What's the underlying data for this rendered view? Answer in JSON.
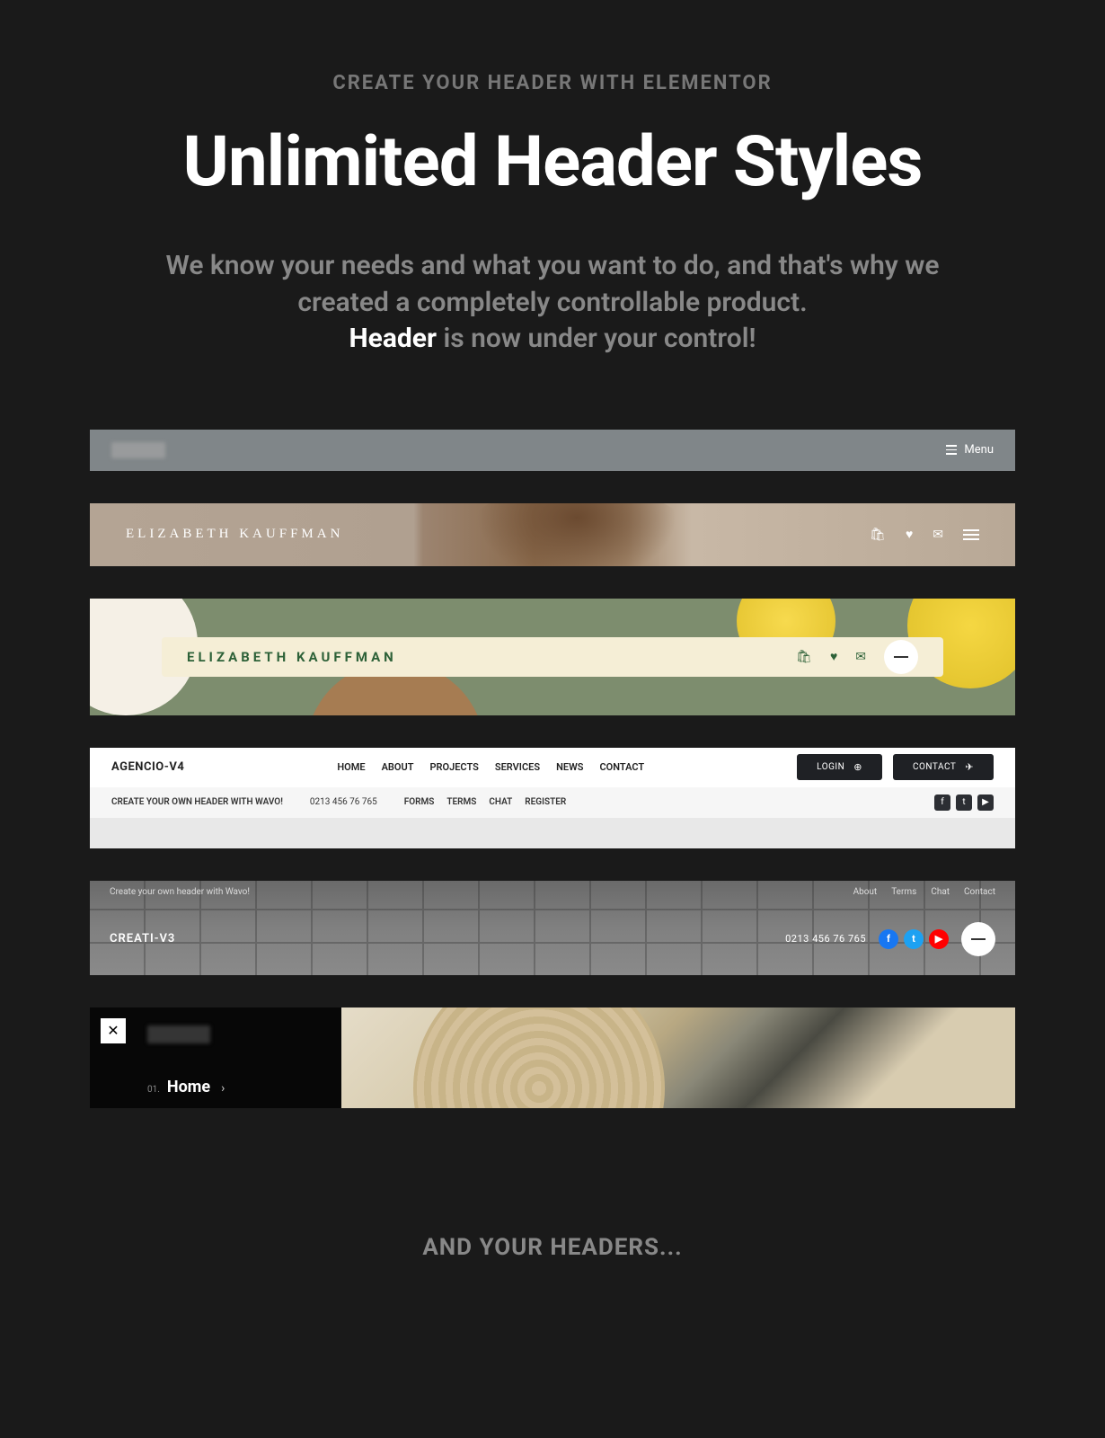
{
  "eyebrow": "CREATE YOUR HEADER WITH ELEMENTOR",
  "title": "Unlimited Header Styles",
  "desc_1": "We know your needs and what you want to do, and that's why we created a completely controllable product.",
  "desc_bold": "Header",
  "desc_2": " is now under your control!",
  "h1": {
    "menu": "Menu"
  },
  "h2": {
    "name": "ELIZABETH KAUFFMAN"
  },
  "h3": {
    "name": "ELIZABETH KAUFFMAN"
  },
  "h4": {
    "brand": "AGENCIO-V4",
    "nav": [
      "HOME",
      "ABOUT",
      "PROJECTS",
      "SERVICES",
      "NEWS",
      "CONTACT"
    ],
    "login": "LOGIN",
    "contact": "CONTACT",
    "sub_tag": "CREATE YOUR OWN HEADER WITH WAVO!",
    "sub_phone": "0213 456 76 765",
    "sub_links": [
      "FORMS",
      "TERMS",
      "CHAT",
      "REGISTER"
    ]
  },
  "h5": {
    "top_tag": "Create your own header with Wavo!",
    "top_links": [
      "About",
      "Terms",
      "Chat",
      "Contact"
    ],
    "brand": "CREATI-V3",
    "phone": "0213 456 76 765"
  },
  "h6": {
    "num": "01.",
    "home": "Home",
    "chev": "›"
  },
  "footer": "AND YOUR HEADERS..."
}
